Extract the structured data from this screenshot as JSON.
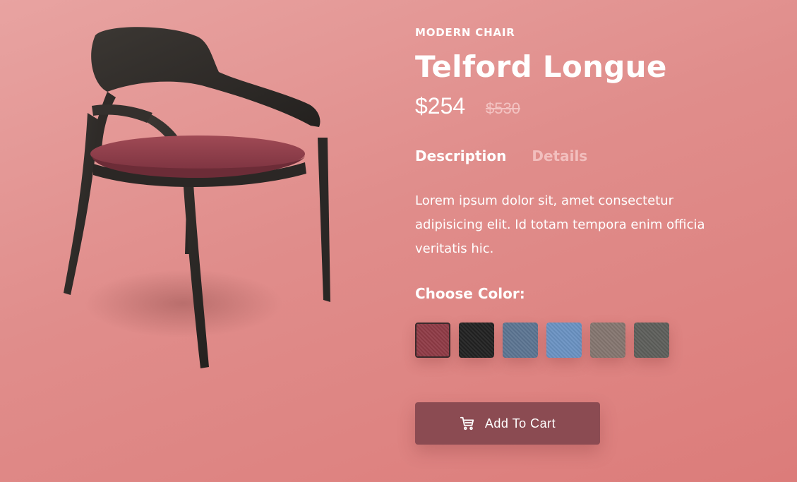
{
  "product": {
    "category": "MODERN CHAIR",
    "name": "Telford Longue",
    "price": "$254",
    "old_price": "$530",
    "image_icon": "chair-image"
  },
  "tabs": [
    {
      "label": "Description",
      "active": true
    },
    {
      "label": "Details",
      "active": false
    }
  ],
  "description": "Lorem ipsum dolor sit, amet consectetur adipisicing elit. Id totam tempora enim officia veritatis hic.",
  "colors": {
    "label": "Choose Color:",
    "swatches": [
      {
        "color": "#8f3b46",
        "selected": true
      },
      {
        "color": "#222222",
        "selected": false
      },
      {
        "color": "#5c7592",
        "selected": false
      },
      {
        "color": "#6a92c2",
        "selected": false
      },
      {
        "color": "#857670",
        "selected": false
      },
      {
        "color": "#5e5f5b",
        "selected": false
      }
    ]
  },
  "cart": {
    "label": "Add To Cart",
    "icon": "cart-icon"
  },
  "theme": {
    "background": "#e08d8b",
    "button": "#8b4b52"
  }
}
